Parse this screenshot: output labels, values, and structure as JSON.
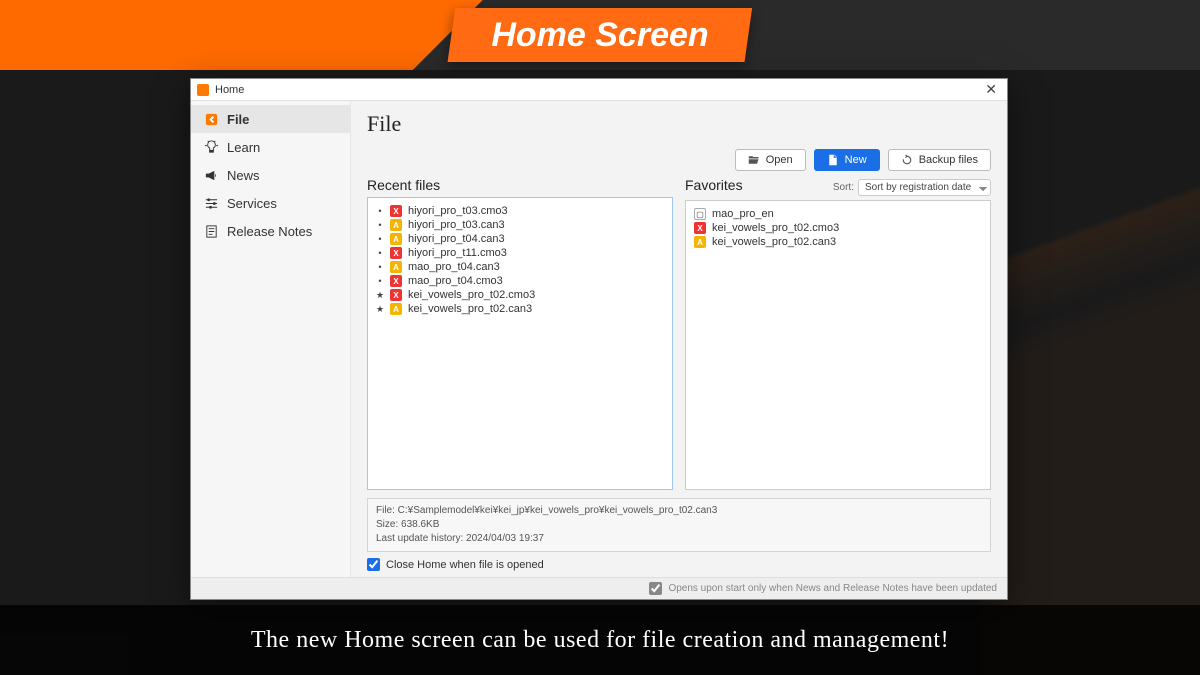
{
  "banner_title": "Home Screen",
  "caption": "The new Home screen can be used for file creation and management!",
  "window": {
    "title": "Home"
  },
  "sidebar": {
    "items": [
      {
        "label": "File",
        "icon": "file-back-icon",
        "active": true
      },
      {
        "label": "Learn",
        "icon": "lightbulb-icon",
        "active": false
      },
      {
        "label": "News",
        "icon": "megaphone-icon",
        "active": false
      },
      {
        "label": "Services",
        "icon": "slider-icon",
        "active": false
      },
      {
        "label": "Release Notes",
        "icon": "notes-icon",
        "active": false
      }
    ]
  },
  "page": {
    "title": "File",
    "toolbar": {
      "open": "Open",
      "new": "New",
      "backup": "Backup files"
    },
    "recent": {
      "title": "Recent files",
      "items": [
        {
          "mark": "•",
          "type": "x",
          "name": "hiyori_pro_t03.cmo3"
        },
        {
          "mark": "•",
          "type": "a",
          "name": "hiyori_pro_t03.can3"
        },
        {
          "mark": "•",
          "type": "a",
          "name": "hiyori_pro_t04.can3"
        },
        {
          "mark": "•",
          "type": "x",
          "name": "hiyori_pro_t11.cmo3"
        },
        {
          "mark": "•",
          "type": "a",
          "name": "mao_pro_t04.can3"
        },
        {
          "mark": "•",
          "type": "x",
          "name": "mao_pro_t04.cmo3"
        },
        {
          "mark": "★",
          "type": "x",
          "name": "kei_vowels_pro_t02.cmo3"
        },
        {
          "mark": "★",
          "type": "a",
          "name": "kei_vowels_pro_t02.can3"
        }
      ]
    },
    "favorites": {
      "title": "Favorites",
      "sort_label": "Sort:",
      "sort_value": "Sort by registration date",
      "items": [
        {
          "type": "f",
          "name": "mao_pro_en"
        },
        {
          "type": "x",
          "name": "kei_vowels_pro_t02.cmo3"
        },
        {
          "type": "a",
          "name": "kei_vowels_pro_t02.can3"
        }
      ]
    },
    "info": {
      "path": "File: C:¥Samplemodel¥kei¥kei_jp¥kei_vowels_pro¥kei_vowels_pro_t02.can3",
      "size": "Size: 638.6KB",
      "updated": "Last update history: 2024/04/03 19:37"
    },
    "close_on_open_label": "Close Home when file is opened",
    "close_on_open_checked": true,
    "footer_label": "Opens upon start only when News and Release Notes have been updated",
    "footer_checked": true
  }
}
